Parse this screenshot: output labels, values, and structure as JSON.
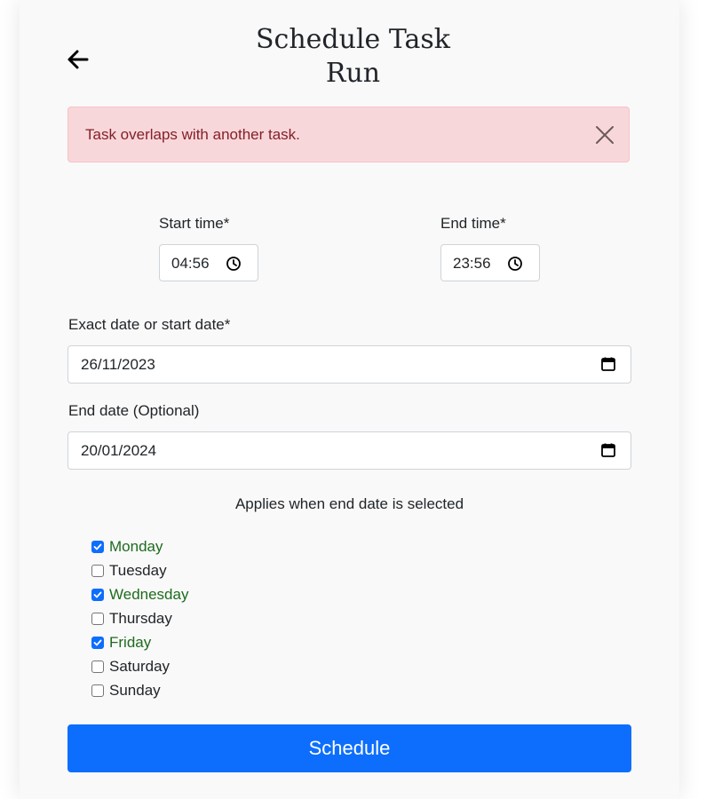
{
  "header": {
    "title_line1": "Schedule Task",
    "title_line2": "Run"
  },
  "alert": {
    "message": "Task overlaps with another task."
  },
  "form": {
    "start_time_label": "Start time*",
    "start_time_value": "04:56",
    "end_time_label": "End time*",
    "end_time_value": "23:56",
    "start_date_label": "Exact date or start date*",
    "start_date_value": "26/11/2023",
    "end_date_label": "End date (Optional)",
    "end_date_value": "20/01/2024",
    "applies_text": "Applies when end date is selected",
    "days": [
      {
        "label": "Monday",
        "checked": true
      },
      {
        "label": "Tuesday",
        "checked": false
      },
      {
        "label": "Wednesday",
        "checked": true
      },
      {
        "label": "Thursday",
        "checked": false
      },
      {
        "label": "Friday",
        "checked": true
      },
      {
        "label": "Saturday",
        "checked": false
      },
      {
        "label": "Sunday",
        "checked": false
      }
    ],
    "submit_label": "Schedule"
  },
  "colors": {
    "primary": "#0d6efd",
    "alert_bg": "#f8d7da",
    "alert_text": "#842029",
    "checked_day_text": "#1e6b1e"
  }
}
